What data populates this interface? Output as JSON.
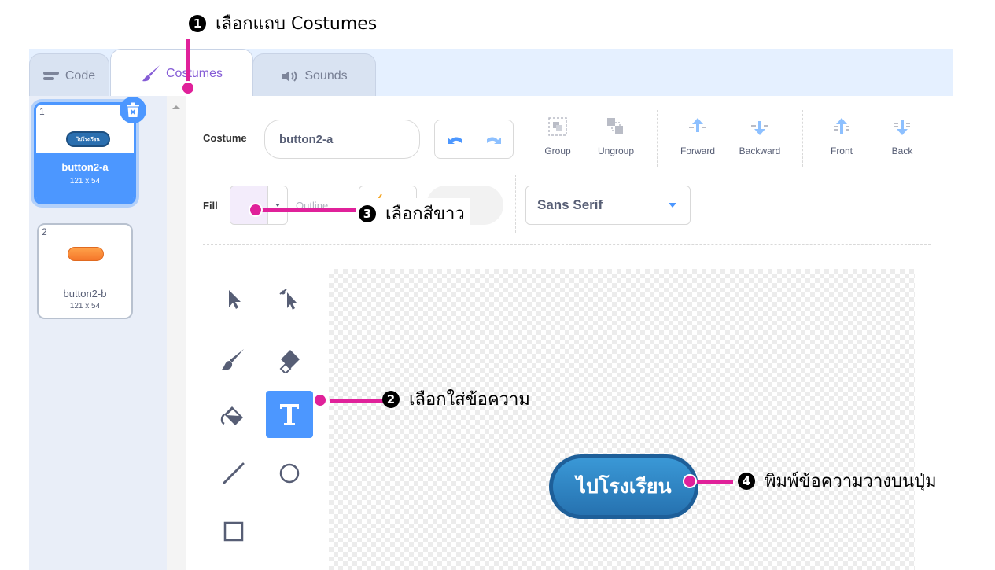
{
  "annotations": {
    "step1": {
      "num": "1",
      "text": "เลือกแถบ Costumes"
    },
    "step2": {
      "num": "2",
      "text": "เลือกใส่ข้อความ"
    },
    "step3": {
      "num": "3",
      "text": "เลือกสีขาว"
    },
    "step4": {
      "num": "4",
      "text": "พิมพ์ข้อความวางบนปุ่ม"
    }
  },
  "tabs": [
    {
      "label": "Code",
      "icon": "code-icon"
    },
    {
      "label": "Costumes",
      "icon": "brush-icon"
    },
    {
      "label": "Sounds",
      "icon": "speaker-icon"
    }
  ],
  "costumes": [
    {
      "num": "1",
      "name": "button2-a",
      "size": "121 x 54",
      "thumb_text": "ไปโรงเรียน",
      "selected": true
    },
    {
      "num": "2",
      "name": "button2-b",
      "size": "121 x 54",
      "selected": false
    }
  ],
  "editor": {
    "costume_label": "Costume",
    "costume_name": "button2-a",
    "group": "Group",
    "ungroup": "Ungroup",
    "forward": "Forward",
    "backward": "Backward",
    "front": "Front",
    "back": "Back",
    "fill_label": "Fill",
    "outline_label": "Outline",
    "outline_width": "0",
    "font": "Sans Serif"
  },
  "canvas": {
    "button_text": "ไปโรงเรียน"
  },
  "colors": {
    "accent": "#4c97ff",
    "highlight": "#e0219a",
    "button_fill": "#2a7fc0"
  }
}
